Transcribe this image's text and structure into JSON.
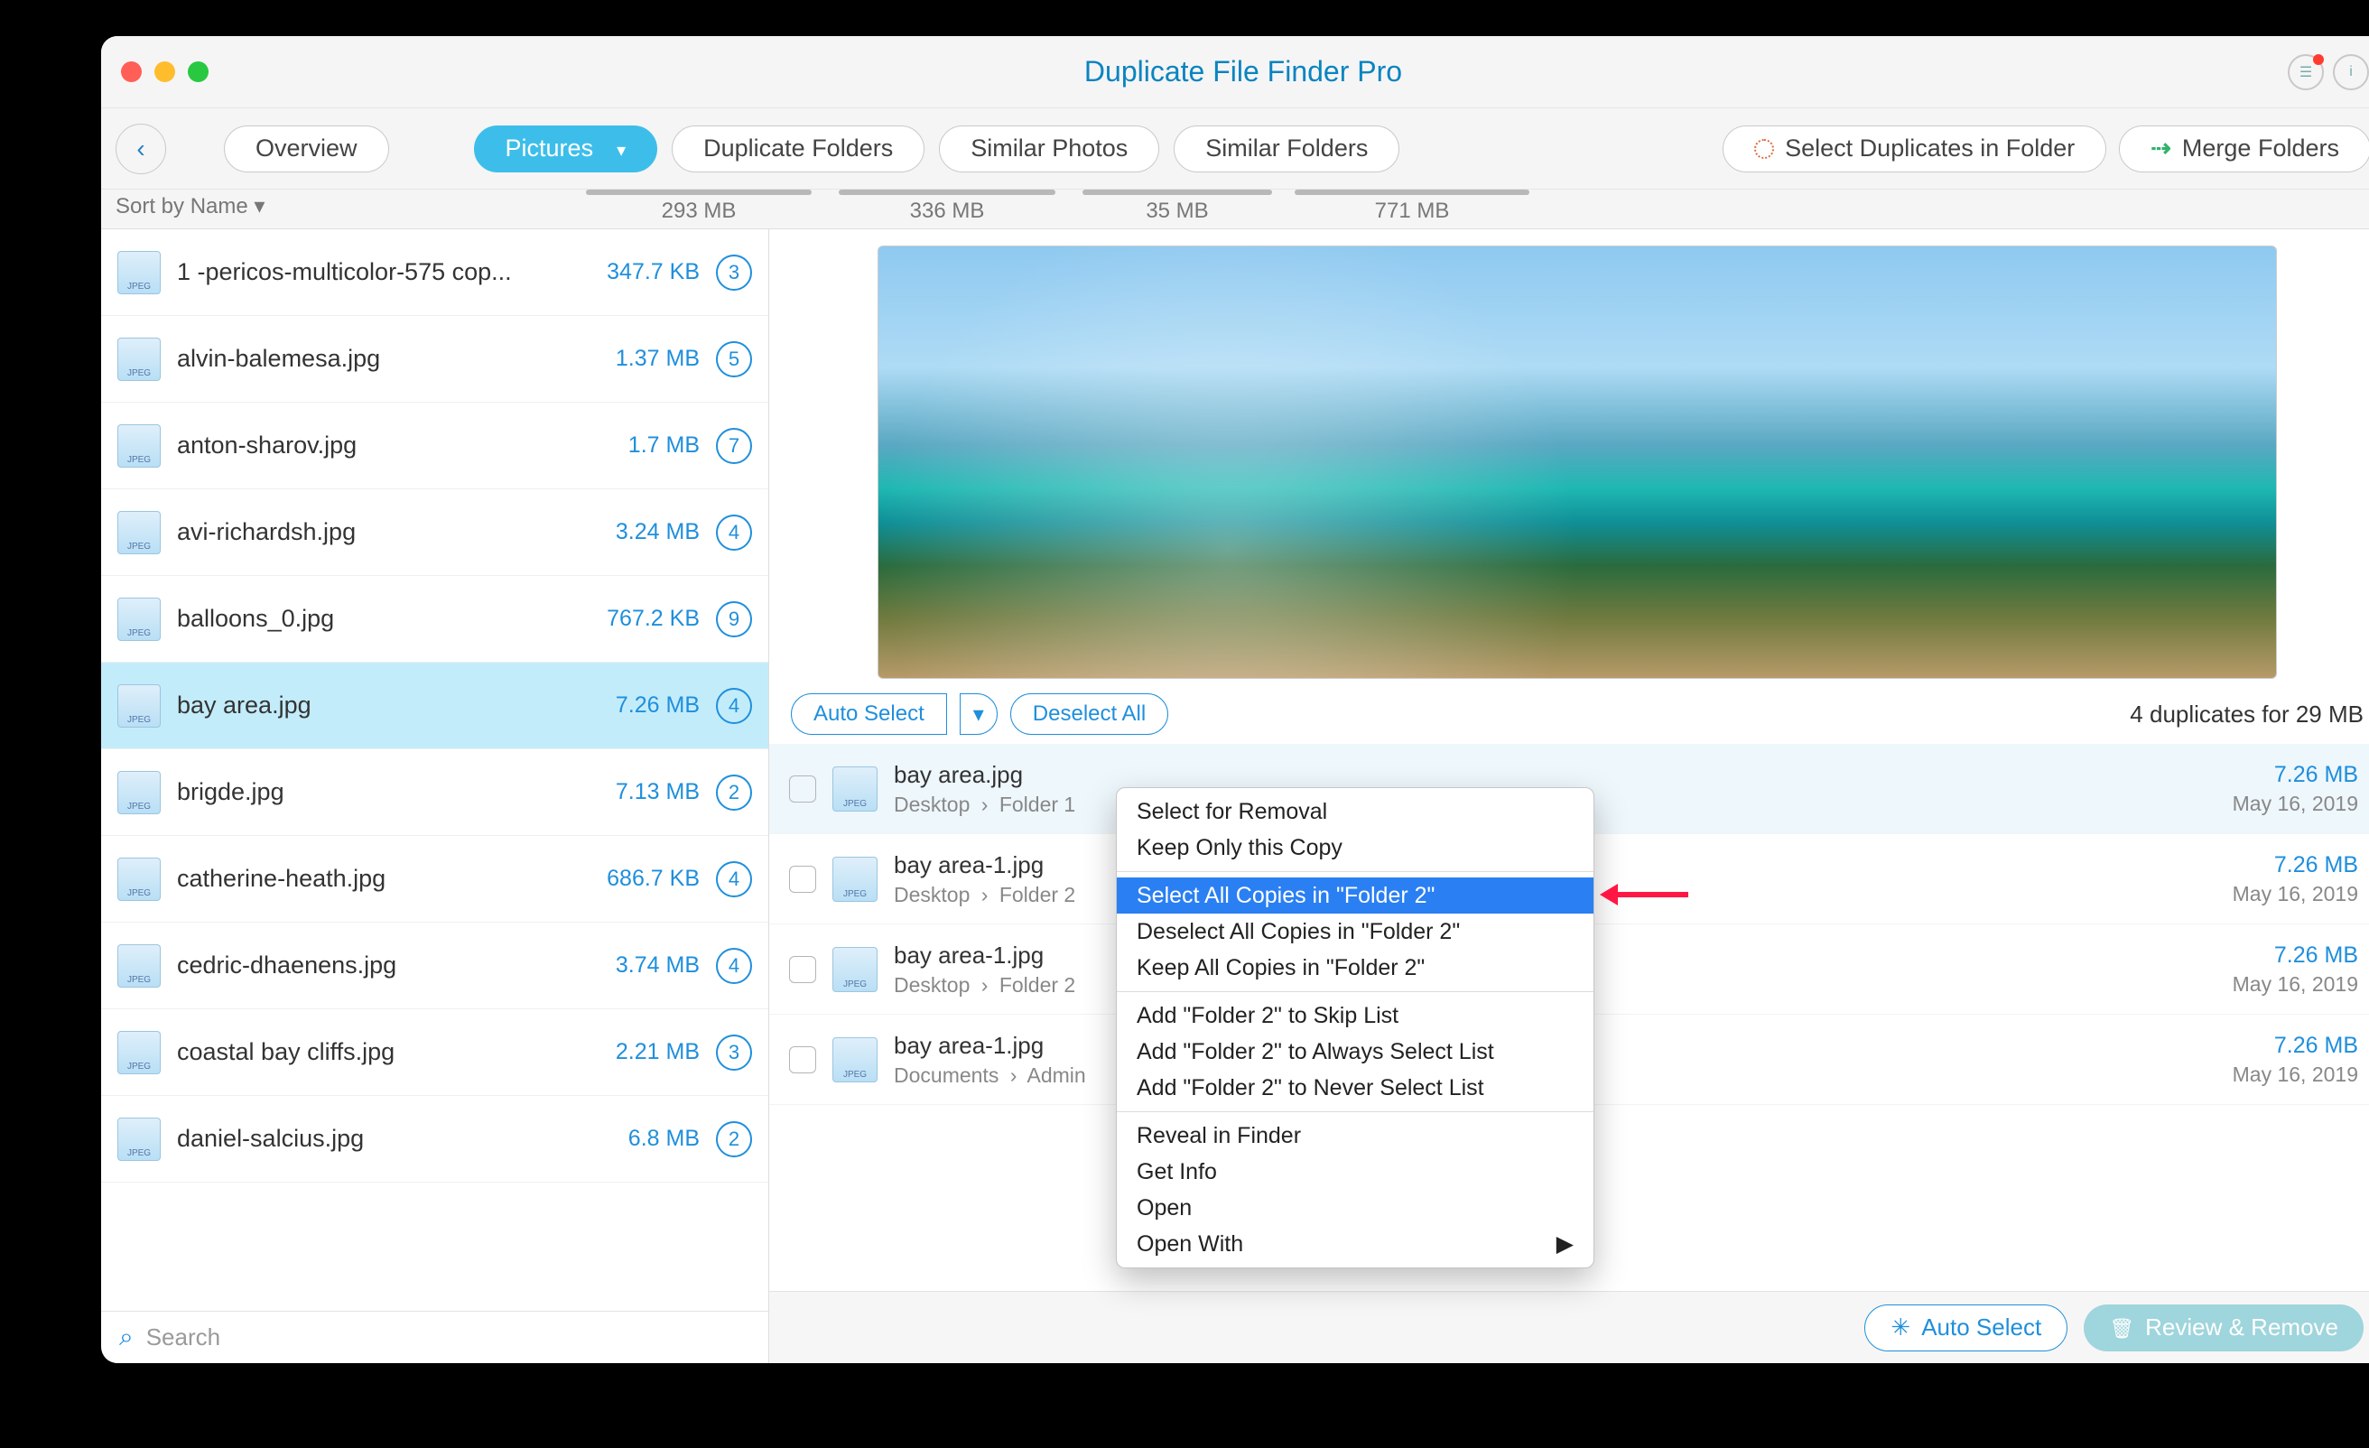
{
  "window": {
    "title": "Duplicate File Finder Pro"
  },
  "toolbar": {
    "overview": "Overview",
    "tabs": {
      "pictures": {
        "label": "Pictures",
        "size": "293 MB",
        "barw": 250
      },
      "dup_folders": {
        "label": "Duplicate Folders",
        "size": "336 MB",
        "barw": 240
      },
      "similar_photos": {
        "label": "Similar Photos",
        "size": "35 MB",
        "barw": 210
      },
      "similar_folders": {
        "label": "Similar Folders",
        "size": "771 MB",
        "barw": 260
      }
    },
    "select_dup": "Select Duplicates in Folder",
    "merge": "Merge Folders"
  },
  "sort_label": "Sort by Name ▾",
  "files": [
    {
      "name": "1 -pericos-multicolor-575 cop...",
      "size": "347.7 KB",
      "count": "3"
    },
    {
      "name": "alvin-balemesa.jpg",
      "size": "1.37 MB",
      "count": "5"
    },
    {
      "name": "anton-sharov.jpg",
      "size": "1.7 MB",
      "count": "7"
    },
    {
      "name": "avi-richardsh.jpg",
      "size": "3.24 MB",
      "count": "4"
    },
    {
      "name": "balloons_0.jpg",
      "size": "767.2 KB",
      "count": "9"
    },
    {
      "name": "bay area.jpg",
      "size": "7.26 MB",
      "count": "4"
    },
    {
      "name": "brigde.jpg",
      "size": "7.13 MB",
      "count": "2"
    },
    {
      "name": "catherine-heath.jpg",
      "size": "686.7 KB",
      "count": "4"
    },
    {
      "name": "cedric-dhaenens.jpg",
      "size": "3.74 MB",
      "count": "4"
    },
    {
      "name": "coastal bay cliffs.jpg",
      "size": "2.21 MB",
      "count": "3"
    },
    {
      "name": "daniel-salcius.jpg",
      "size": "6.8 MB",
      "count": "2"
    }
  ],
  "search_placeholder": "Search",
  "controls": {
    "auto_select": "Auto Select",
    "deselect_all": "Deselect All",
    "summary": "4 duplicates for 29 MB"
  },
  "dups": [
    {
      "name": "bay area.jpg",
      "path1": "Desktop",
      "path2": "Folder 1",
      "size": "7.26 MB",
      "date": "May 16, 2019"
    },
    {
      "name": "bay area-1.jpg",
      "path1": "Desktop",
      "path2": "Folder 2",
      "size": "7.26 MB",
      "date": "May 16, 2019"
    },
    {
      "name": "bay area-1.jpg",
      "path1": "Desktop",
      "path2": "Folder 2",
      "size": "7.26 MB",
      "date": "May 16, 2019"
    },
    {
      "name": "bay area-1.jpg",
      "path1": "Documents",
      "path2": "Admin",
      "size": "7.26 MB",
      "date": "May 16, 2019"
    }
  ],
  "footer": {
    "auto_select": "Auto Select",
    "review": "Review & Remove"
  },
  "ctx": {
    "i0": "Select for Removal",
    "i1": "Keep Only this Copy",
    "i2": "Select All Copies in \"Folder 2\"",
    "i3": "Deselect All Copies in \"Folder 2\"",
    "i4": "Keep All Copies in \"Folder 2\"",
    "i5": "Add \"Folder 2\" to Skip List",
    "i6": "Add \"Folder 2\" to Always Select List",
    "i7": "Add \"Folder 2\" to Never Select List",
    "i8": "Reveal in Finder",
    "i9": "Get Info",
    "i10": "Open",
    "i11": "Open With"
  }
}
